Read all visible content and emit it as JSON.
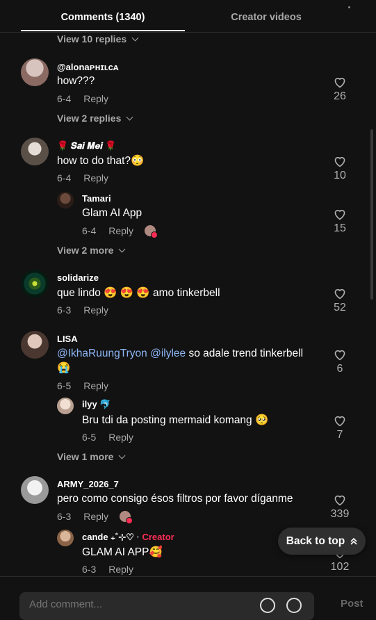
{
  "tabs": [
    {
      "label": "Comments (1340)",
      "active": true
    },
    {
      "label": "Creator videos",
      "active": false
    }
  ],
  "expanders": {
    "top": "View 10 replies",
    "c1": "View 2 replies",
    "c2": "View 2 more",
    "c4": "View 1 more"
  },
  "comments": [
    {
      "user": "@alonaᴘʜɪʟᴄᴀ",
      "text": "how???",
      "date": "6-4",
      "reply": "Reply",
      "likes": "26"
    },
    {
      "user": "🌹 𝑺𝒂𝒊 𝑴𝒆𝒊 🌹",
      "text": "how to do that?😳",
      "date": "6-4",
      "reply": "Reply",
      "likes": "10",
      "replies": [
        {
          "user": "Tamari",
          "text": "Glam AI App",
          "date": "6-4",
          "reply": "Reply",
          "likes": "15"
        }
      ]
    },
    {
      "user": "solidarize",
      "text": "que lindo 😍 😍 😍 amo tinkerbell",
      "date": "6-3",
      "reply": "Reply",
      "likes": "52"
    },
    {
      "user": "LISA",
      "mention1": "@IkhaRuungTryon",
      "mention2": "@ilylee",
      "text": " so adale trend tinkerbell",
      "text2": "😭",
      "date": "6-5",
      "reply": "Reply",
      "likes": "6",
      "replies": [
        {
          "user": "ilyy 🐬",
          "text": "Bru tdi da posting mermaid komang 🥺",
          "date": "6-5",
          "reply": "Reply",
          "likes": "7"
        }
      ]
    },
    {
      "user": "ARMY_2026_7",
      "text": "pero como consigo ésos filtros por favor díganme",
      "date": "6-3",
      "reply": "Reply",
      "likes": "339",
      "replies": [
        {
          "user": "cande ₊˚⊹♡",
          "sep": " · ",
          "badge": "Creator",
          "text": "GLAM AI APP🥰",
          "date": "6-3",
          "reply": "Reply",
          "likes": "102"
        }
      ]
    }
  ],
  "back_to_top": "Back to top",
  "input": {
    "placeholder": "Add comment..."
  },
  "post": "Post",
  "colors": {
    "background": "#121212",
    "muted": "#a8a8a8",
    "mention": "#8eb6f6",
    "creator": "#fe2c55"
  },
  "icons": [
    "heart-outline-icon",
    "chevron-down-icon",
    "double-chevron-up-icon",
    "emoji-icon",
    "at-icon"
  ]
}
